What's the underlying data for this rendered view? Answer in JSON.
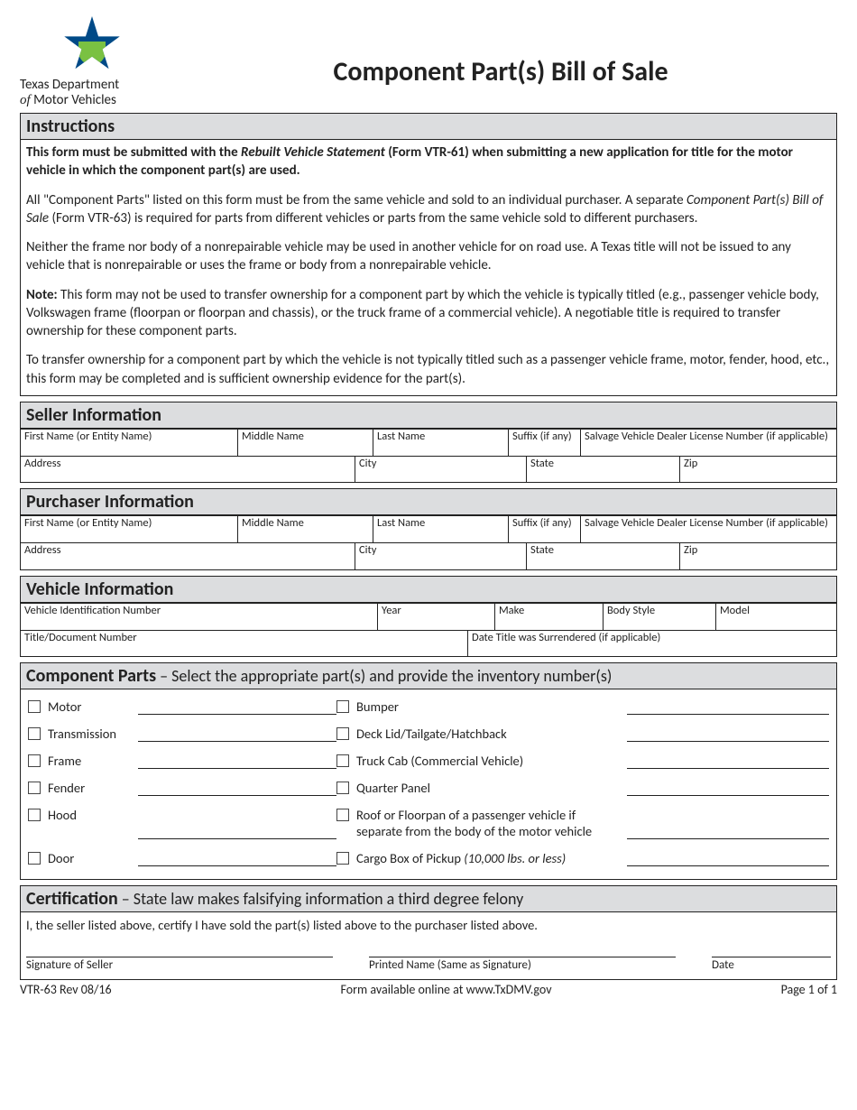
{
  "logo": {
    "line1": "Texas Department",
    "line2_prefix": "of",
    "line2_rest": " Motor Vehicles"
  },
  "title": "Component Part(s) Bill of Sale",
  "instructions": {
    "heading": "Instructions",
    "p1_a": "This form must be submitted with the ",
    "p1_ital": "Rebuilt Vehicle Statement",
    "p1_b": " (Form VTR-61) when submitting a new application for title for the motor vehicle in which the component part(s) are used.",
    "p2_a": "All \"Component Parts\" listed on this form must be from the same vehicle and sold to an individual purchaser.  A separate ",
    "p2_ital": "Component Part(s) Bill of Sale",
    "p2_b": " (Form VTR-63) is required for parts from different vehicles or parts from the same vehicle sold to different purchasers.",
    "p3": "Neither the frame nor body of a nonrepairable vehicle may be used in another vehicle for on road use.  A Texas title will not be issued to any vehicle that is nonrepairable or uses the frame or body from a nonrepairable vehicle.",
    "p4_a": "Note:",
    "p4_b": " This form may not be used to transfer ownership for a component part by which the vehicle is typically titled (e.g., passenger vehicle body, Volkswagen frame (floorpan or floorpan and chassis), or the truck frame of a commercial vehicle). A negotiable title is required to transfer ownership for these component parts.",
    "p5": "To transfer ownership for a component part by which the vehicle is not typically titled such as a passenger vehicle frame, motor, fender, hood, etc., this form may be completed and is sufficient ownership evidence for the part(s)."
  },
  "seller": {
    "heading": "Seller Information",
    "fields": {
      "first_name": "First Name (or Entity Name)",
      "middle_name": "Middle Name",
      "last_name": "Last Name",
      "suffix": "Suffix (if any)",
      "license": "Salvage Vehicle Dealer License Number (if applicable)",
      "address": "Address",
      "city": "City",
      "state": "State",
      "zip": "Zip"
    }
  },
  "purchaser": {
    "heading": "Purchaser Information",
    "fields": {
      "first_name": "First Name (or Entity Name)",
      "middle_name": "Middle Name",
      "last_name": "Last Name",
      "suffix": "Suffix (if any)",
      "license": "Salvage Vehicle Dealer License Number (if applicable)",
      "address": "Address",
      "city": "City",
      "state": "State",
      "zip": "Zip"
    }
  },
  "vehicle": {
    "heading": "Vehicle Information",
    "fields": {
      "vin": "Vehicle Identification Number",
      "year": "Year",
      "make": "Make",
      "body": "Body Style",
      "model": "Model",
      "title_doc": "Title/Document Number",
      "surrendered": "Date Title was Surrendered (if applicable)"
    }
  },
  "parts": {
    "heading_bold": "Component Parts",
    "heading_rest": " – Select the appropriate part(s) and provide the inventory number(s)",
    "left": [
      "Motor",
      "Transmission",
      "Frame",
      "Fender",
      "Hood",
      "Door"
    ],
    "right": [
      "Bumper",
      "Deck Lid/Tailgate/Hatchback",
      "Truck Cab (Commercial Vehicle)",
      "Quarter Panel",
      "Roof or Floorpan of a passenger vehicle if separate from the body of the motor vehicle",
      "Cargo Box of Pickup "
    ],
    "right_5_ital": "(10,000 lbs. or less)"
  },
  "cert": {
    "heading_bold": "Certification",
    "heading_rest": " – State law makes falsifying information a third degree felony",
    "statement": "I, the seller listed above, certify I have sold the part(s) listed above to the purchaser listed above.",
    "sig": "Signature of Seller",
    "printed": "Printed Name (Same as Signature)",
    "date": "Date"
  },
  "footer": {
    "left": "VTR-63 Rev 08/16",
    "center": "Form available online at www.TxDMV.gov",
    "right": "Page 1 of 1"
  }
}
